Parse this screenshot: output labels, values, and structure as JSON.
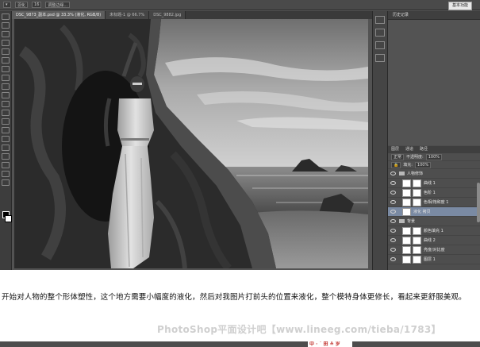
{
  "options_bar": {
    "items": [
      "▾",
      "羽化",
      "16",
      "调整边缘..."
    ],
    "workspace": "基本功能"
  },
  "document_tabs": [
    "DSC_9873_副本.psd @ 33.3% (液化, RGB/8)",
    "未标题-1 @ 66.7%",
    "DSC_9882.jpg"
  ],
  "panels": {
    "history_title": "历史记录",
    "layers_tabs": [
      "图层",
      "通道",
      "路径"
    ],
    "blend_mode": "正常",
    "opacity_label": "不透明度:",
    "opacity_value": "100%",
    "fill_label": "填充:",
    "fill_value": "100%",
    "layers": [
      {
        "name": "人物修饰",
        "kind": "group",
        "selected": false
      },
      {
        "name": "曲线 1",
        "kind": "adjust",
        "selected": false
      },
      {
        "name": "色阶 1",
        "kind": "adjust",
        "selected": false
      },
      {
        "name": "色相/饱和度 1",
        "kind": "adjust",
        "selected": false
      },
      {
        "name": "液化 拷贝",
        "kind": "layer",
        "selected": true
      },
      {
        "name": "背景",
        "kind": "group",
        "selected": false
      },
      {
        "name": "颜色填充 1",
        "kind": "adjust",
        "selected": false
      },
      {
        "name": "曲线 2",
        "kind": "adjust",
        "selected": false
      },
      {
        "name": "亮度/对比度",
        "kind": "adjust",
        "selected": false
      },
      {
        "name": "图层 1",
        "kind": "adjust",
        "selected": false
      }
    ]
  },
  "article": {
    "caption": "开始对人物的整个形体塑性，这个地方需要小幅度的液化，然后对我图片打前头的位置来液化，整个模特身体更修长，看起来更舒服美观。",
    "watermark": "PhotoShop平面设计吧【www.lineeg.com/tieba/1783】"
  },
  "bottom_bar": {
    "label": "中 ∙ ˙ 田 ≜ 岁"
  }
}
